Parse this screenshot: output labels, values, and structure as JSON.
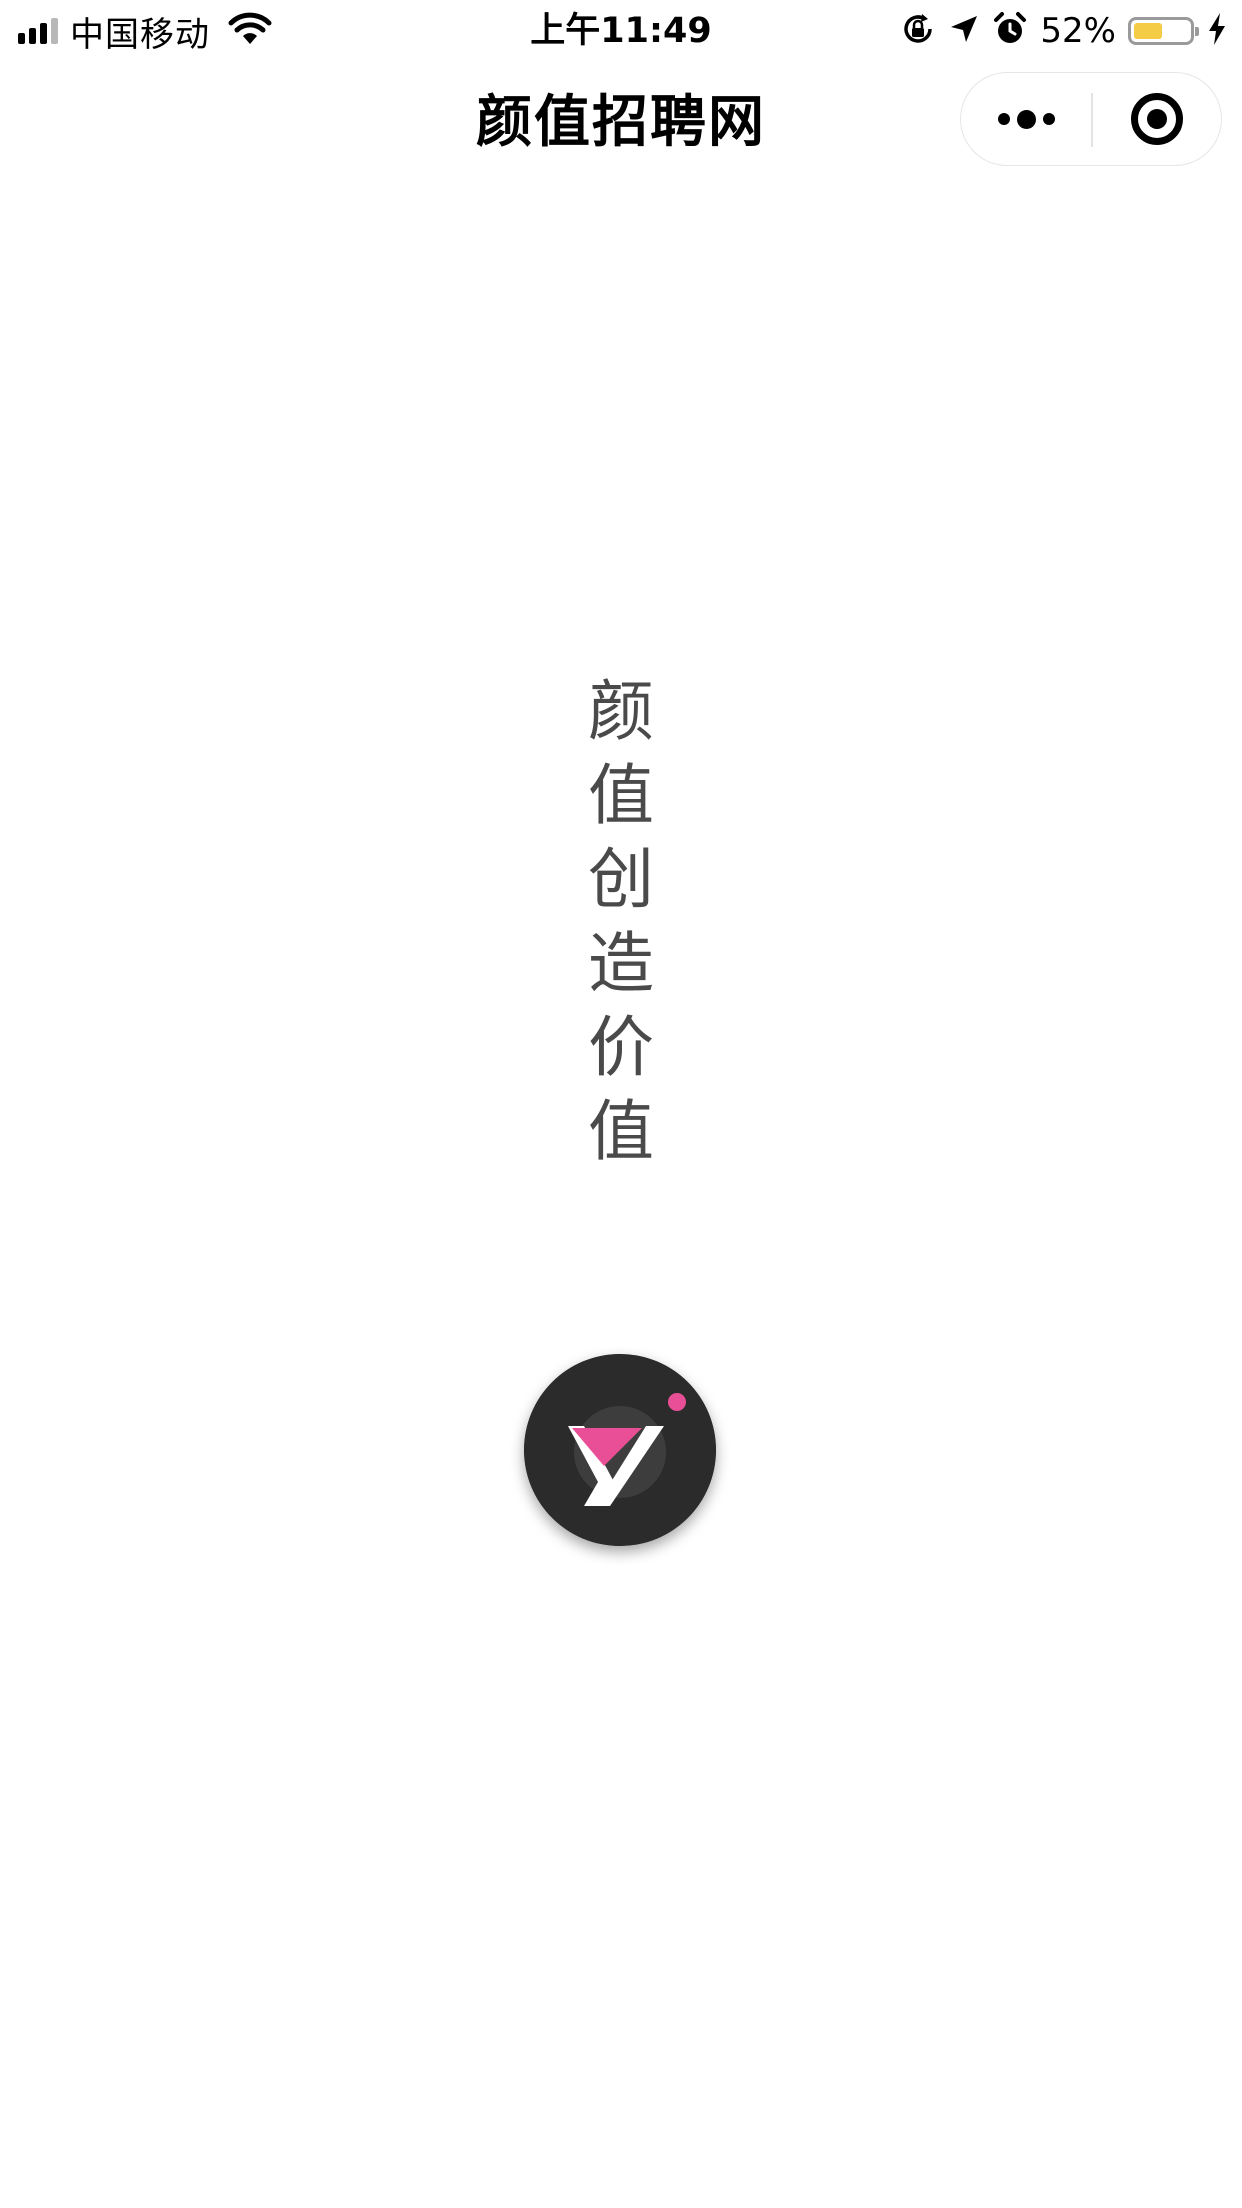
{
  "status_bar": {
    "carrier": "中国移动",
    "time": "上午11:49",
    "battery_percent": "52%",
    "battery_level": 0.52,
    "battery_color": "#f5cc45",
    "icons": [
      "signal-icon",
      "wifi-icon",
      "orientation-lock-icon",
      "location-arrow-icon",
      "alarm-icon",
      "battery-icon",
      "charging-bolt-icon"
    ]
  },
  "nav_bar": {
    "title": "颜值招聘网",
    "more_icon": "more-dots-icon",
    "close_icon": "close-circle-icon"
  },
  "main": {
    "slogan": [
      "颜",
      "值",
      "创",
      "造",
      "价",
      "值"
    ],
    "logo": {
      "icon": "app-logo-icon",
      "background_color": "#2b2b2c",
      "accent_color": "#e94f96"
    }
  }
}
